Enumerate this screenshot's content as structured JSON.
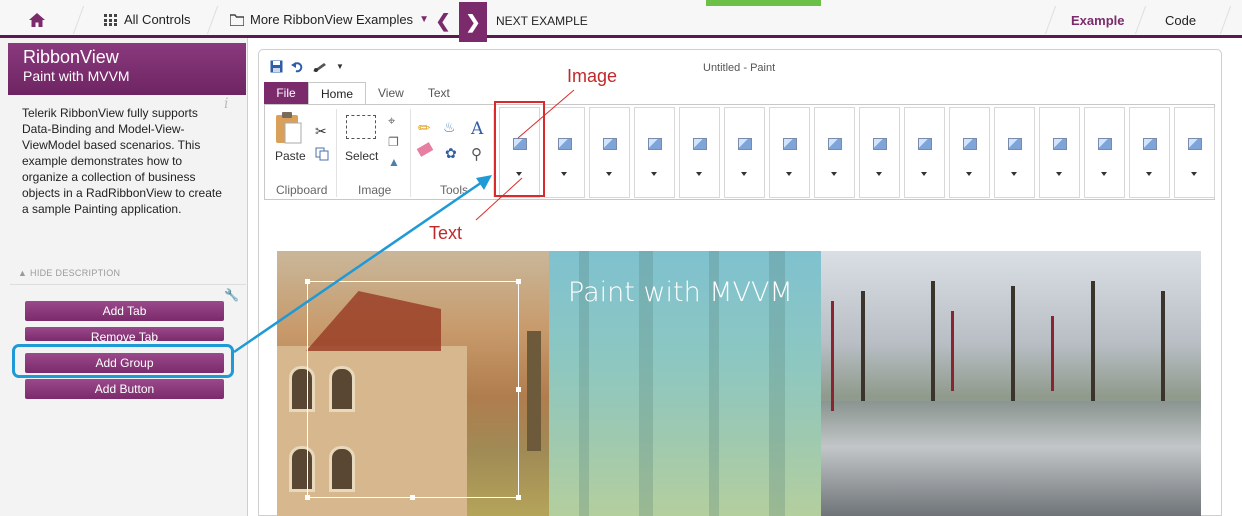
{
  "topbar": {
    "all_controls": "All Controls",
    "more_examples": "More RibbonView Examples",
    "next_example": "NEXT EXAMPLE",
    "tab_example": "Example",
    "tab_code": "Code"
  },
  "sidebar": {
    "title": "RibbonView",
    "subtitle": "Paint with MVVM",
    "description": "Telerik RibbonView fully supports Data-Binding and Model-View-ViewModel based scenarios. This example demonstrates how to organize a collection of business objects in a RadRibbonView to create a sample Painting application.",
    "hide_description": "HIDE DESCRIPTION",
    "buttons": [
      "Add Tab",
      "Remove Tab",
      "Add Group",
      "Add Button"
    ]
  },
  "window": {
    "title": "Untitled - Paint",
    "tabs": [
      "File",
      "Home",
      "View",
      "Text"
    ],
    "active_tab": "Home"
  },
  "ribbon": {
    "paste_label": "Paste",
    "select_label": "Select",
    "groups": [
      "Clipboard",
      "Image",
      "Tools"
    ],
    "gallery_count": 16
  },
  "annotations": {
    "image_label": "Image",
    "text_label": "Text"
  },
  "banner": {
    "title": "Paint with MVVM"
  },
  "colors": {
    "brand_purple": "#7b2b6c",
    "annotation_red": "#d92b2b",
    "annotation_blue": "#1f9ad6"
  }
}
